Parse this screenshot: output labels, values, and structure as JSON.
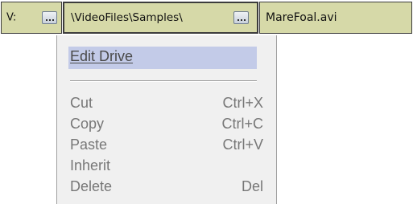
{
  "path_bar": {
    "drive": {
      "label": "V:",
      "browse_icon": "ellipsis-icon"
    },
    "folder": {
      "label": "\\VideoFiles\\Samples\\",
      "browse_icon": "ellipsis-icon"
    },
    "file": {
      "label": "MareFoal.avi"
    }
  },
  "context_menu": {
    "edit_drive": "Edit Drive",
    "items": [
      {
        "label": "Cut",
        "shortcut": "Ctrl+X"
      },
      {
        "label": "Copy",
        "shortcut": "Ctrl+C"
      },
      {
        "label": "Paste",
        "shortcut": "Ctrl+V"
      },
      {
        "label": "Inherit",
        "shortcut": ""
      },
      {
        "label": "Delete",
        "shortcut": "Del"
      }
    ]
  },
  "colors": {
    "path_segment_bg": "#d6d9a8",
    "menu_bg": "#f0f0f0",
    "highlight": "#c3cbe8",
    "menu_text": "#777777"
  }
}
